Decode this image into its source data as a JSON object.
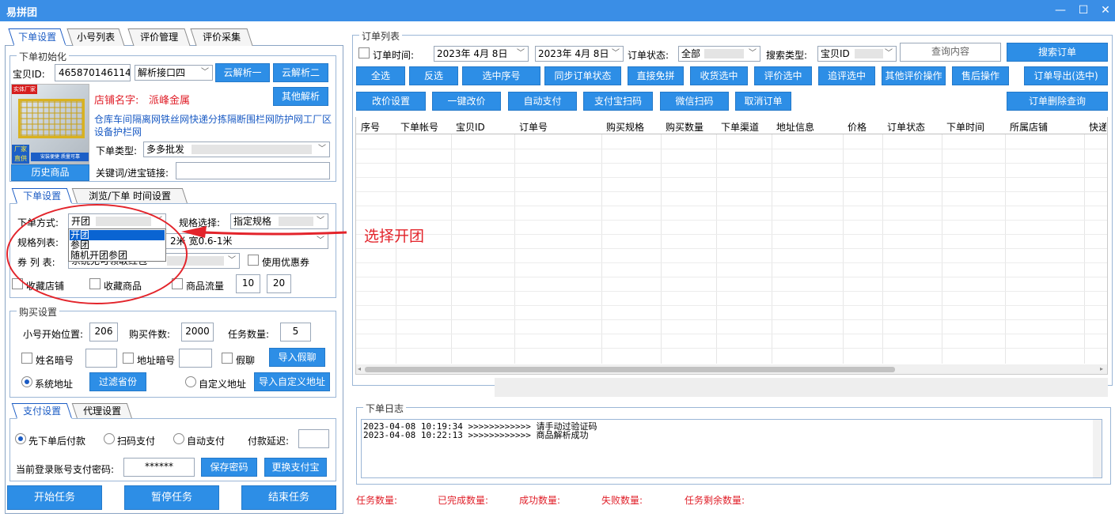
{
  "window": {
    "title": "易拼团",
    "minimize": "—",
    "maximize": "☐",
    "close": "✕"
  },
  "left_tabs": [
    "下单设置",
    "小号列表",
    "评价管理",
    "评价采集"
  ],
  "init": {
    "group_label": "下单初始化",
    "item_id_label": "宝贝ID:",
    "item_id": "465870146114",
    "parse_api": "解析接口四",
    "cloud_parse_1": "云解析一",
    "cloud_parse_2": "云解析二",
    "shop_name_label": "店铺名字:",
    "shop_name": "派峰金属",
    "other_parse": "其他解析",
    "product_title": "仓库车间隔离网铁丝网快递分拣隔断围栏网防护网工厂区设备护栏网",
    "history_btn": "历史商品",
    "order_type_label": "下单类型:",
    "order_type": "多多批发",
    "keyword_label": "关键词/进宝链接:",
    "keyword": "",
    "img_text_top": "实体厂家",
    "img_text_left": "厂家直供",
    "img_text_right": "安装便捷 质量可靠"
  },
  "order_tabs": [
    "下单设置",
    "浏览/下单 时间设置"
  ],
  "order_settings": {
    "mode_label": "下单方式:",
    "mode": "开团",
    "mode_options": [
      "开团",
      "参团",
      "随机开团参团"
    ],
    "spec_select_label": "规格选择:",
    "spec_select": "指定规格",
    "spec_list_label": "规格列表:",
    "spec_list": "2米 宽0.6-1米",
    "coupon_label": "券 列 表:",
    "coupon_value": "系统无可领取红包",
    "use_coupon": "使用优惠券",
    "fav_shop": "收藏店铺",
    "fav_item": "收藏商品",
    "item_flow": "商品流量",
    "flow_min": "10",
    "flow_max": "20"
  },
  "annotation": "选择开团",
  "purchase": {
    "group_label": "购买设置",
    "start_pos_label": "小号开始位置:",
    "start_pos": "206",
    "qty_label": "购买件数:",
    "qty": "2000",
    "task_count_label": "任务数量:",
    "task_count": "5",
    "name_secret": "姓名暗号",
    "addr_secret": "地址暗号",
    "fake_chat": "假聊",
    "import_chat": "导入假聊",
    "system_addr": "系统地址",
    "filter_province": "过滤省份",
    "custom_addr": "自定义地址",
    "import_custom_addr": "导入自定义地址"
  },
  "pay_tabs": [
    "支付设置",
    "代理设置"
  ],
  "payment": {
    "pay_after": "先下单后付款",
    "scan_pay": "扫码支付",
    "auto_pay": "自动支付",
    "delay_label": "付款延迟:",
    "delay": "",
    "pwd_label": "当前登录账号支付密码:",
    "pwd": "******",
    "save_pwd": "保存密码",
    "change_alipay": "更换支付宝"
  },
  "task_buttons": {
    "start": "开始任务",
    "pause": "暂停任务",
    "stop": "结束任务"
  },
  "orders": {
    "group_label": "订单列表",
    "order_time_label": "订单时间:",
    "date_from": "2023年 4月 8日",
    "date_to": "2023年 4月 8日",
    "status_label": "订单状态:",
    "status": "全部",
    "search_type_label": "搜索类型:",
    "search_type": "宝贝ID",
    "query_placeholder": "查询内容",
    "search_btn": "搜索订单",
    "row1": [
      "全选",
      "反选",
      "选中序号",
      "同步订单状态",
      "直接免拼",
      "收货选中",
      "评价选中",
      "追评选中",
      "其他评价操作",
      "售后操作",
      "订单导出(选中)"
    ],
    "row2": [
      "改价设置",
      "一键改价",
      "自动支付",
      "支付宝扫码",
      "微信扫码",
      "取消订单"
    ],
    "delete_query": "订单删除查询",
    "columns": [
      "序号",
      "下单帐号",
      "宝贝ID",
      "订单号",
      "购买规格",
      "购买数量",
      "下单渠道",
      "地址信息",
      "价格",
      "订单状态",
      "下单时间",
      "所属店铺",
      "快递"
    ]
  },
  "log": {
    "group_label": "下单日志",
    "lines": [
      "2023-04-08 10:19:34 >>>>>>>>>>>> 请手动过验证码",
      "2023-04-08 10:22:13 >>>>>>>>>>>> 商品解析成功"
    ]
  },
  "stats": [
    "任务数量:",
    "已完成数量:",
    "成功数量:",
    "失败数量:",
    "任务剩余数量:"
  ],
  "colors": {
    "titlebar": "#3a8ee6",
    "button": "#2d8ee6",
    "accent_red": "#e0202a",
    "link": "#1a5bc4"
  }
}
